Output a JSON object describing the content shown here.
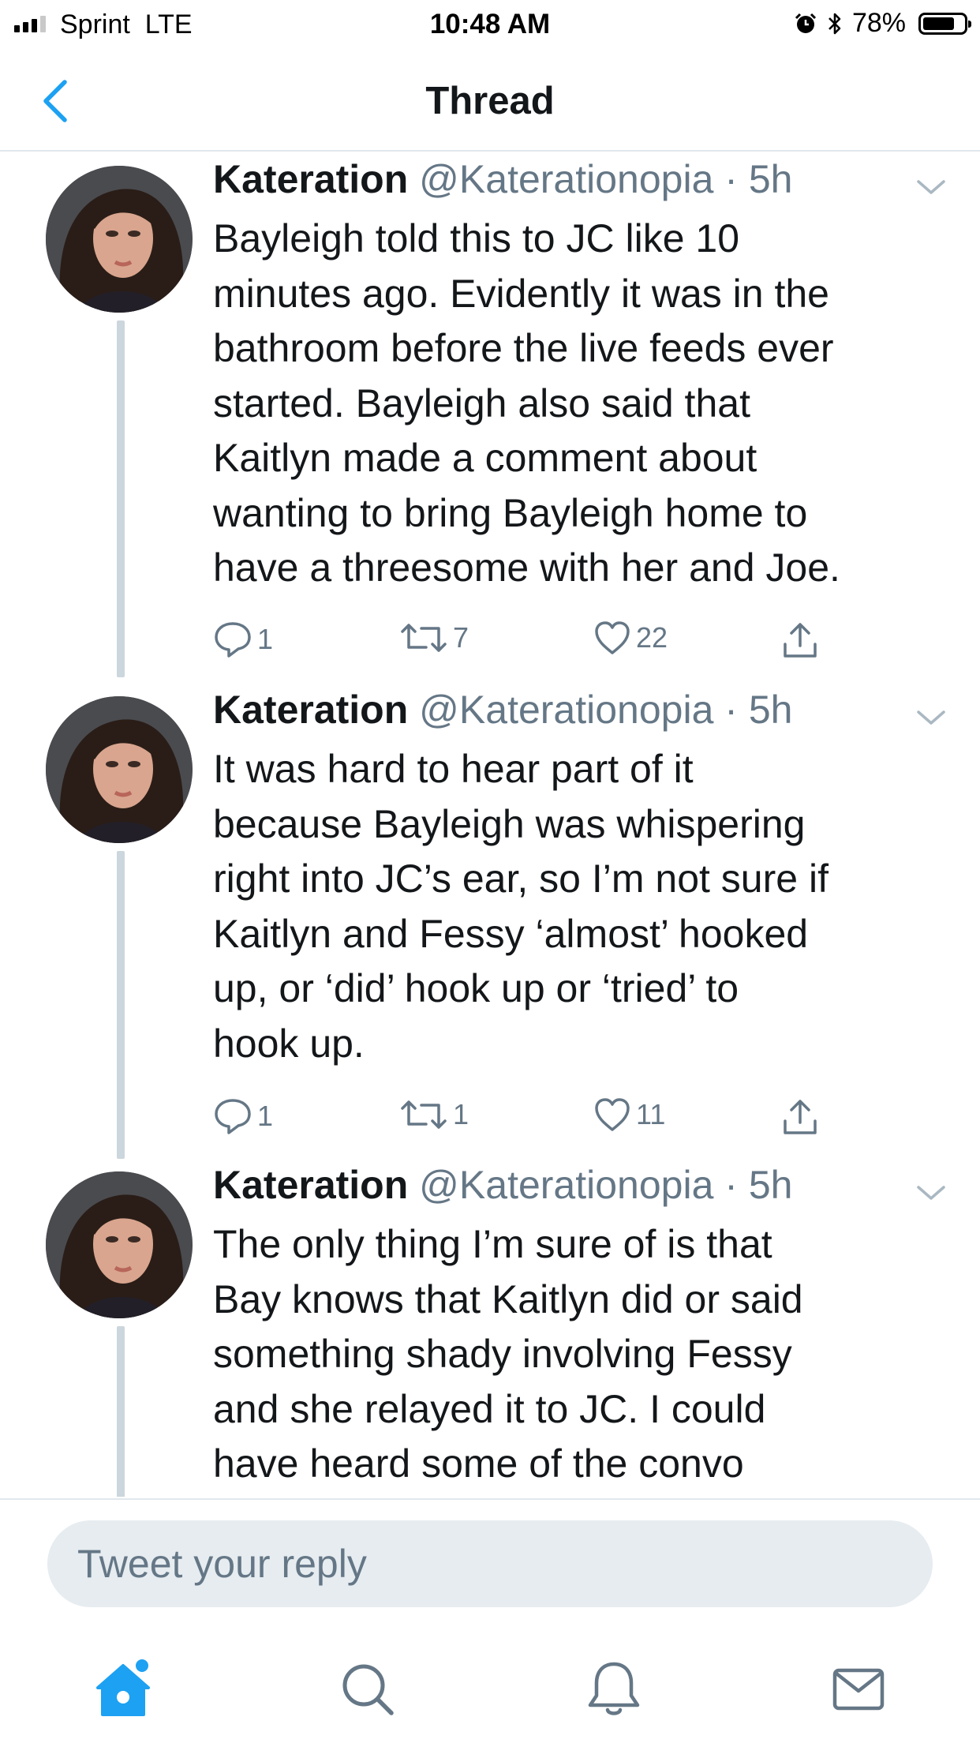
{
  "status_bar": {
    "carrier": "Sprint",
    "network": "LTE",
    "time": "10:48 AM",
    "battery_percent": "78%",
    "battery_level": 0.78
  },
  "nav": {
    "title": "Thread",
    "back_icon": "chevron-left-icon"
  },
  "tweets": [
    {
      "name": "Kateration",
      "handle": "@Katerationopia",
      "time": "5h",
      "lines": [
        "Bayleigh told this to JC like 10",
        "minutes ago. Evidently it was in the",
        "bathroom before the live feeds ever",
        "started. Bayleigh also said that",
        "Kaitlyn made a comment about",
        "wanting to bring Bayleigh home to",
        "have a threesome with her and Joe."
      ],
      "replies": "1",
      "retweets": "7",
      "likes": "22"
    },
    {
      "name": "Kateration",
      "handle": "@Katerationopia",
      "time": "5h",
      "lines": [
        "It was hard to hear part of it",
        "because Bayleigh was whispering",
        "right into JC’s ear, so I’m not sure if",
        "Kaitlyn and Fessy ‘almost’ hooked",
        "up, or ‘did’ hook up or ‘tried’ to",
        "hook up."
      ],
      "replies": "1",
      "retweets": "1",
      "likes": "11"
    },
    {
      "name": "Kateration",
      "handle": "@Katerationopia",
      "time": "5h",
      "lines": [
        "The only thing I’m sure of is that",
        "Bay knows that Kaitlyn did or said",
        "something shady involving Fessy",
        "and she relayed it to JC. I could",
        "have heard some of the convo"
      ]
    }
  ],
  "reply": {
    "placeholder": "Tweet your reply"
  },
  "tabbar": {
    "items": [
      "home-icon",
      "search-icon",
      "notifications-icon",
      "messages-icon"
    ],
    "active_color": "#1da1f2",
    "inactive_color": "#657786"
  }
}
